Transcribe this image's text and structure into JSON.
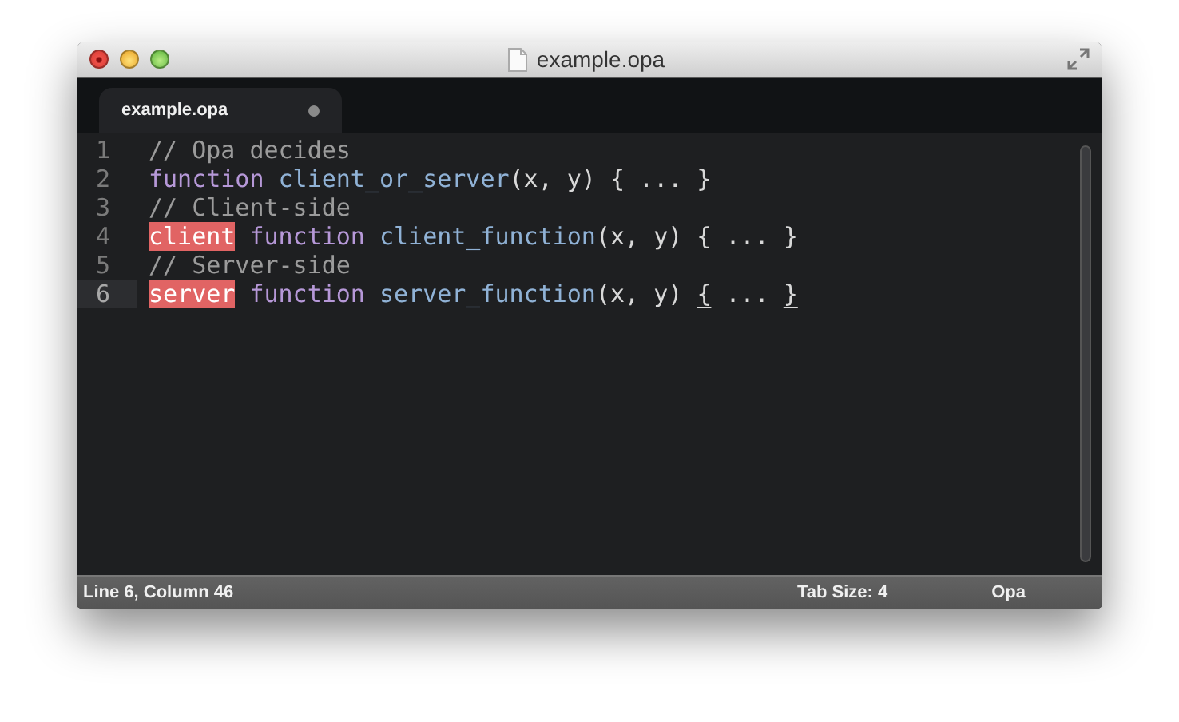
{
  "window": {
    "title": "example.opa"
  },
  "tabs": [
    {
      "label": "example.opa",
      "selected": true,
      "dirty": true
    }
  ],
  "editor": {
    "lines": [
      {
        "number": "1",
        "current": false,
        "tokens": [
          {
            "kind": "comment",
            "text": "// Opa decides"
          }
        ]
      },
      {
        "number": "2",
        "current": false,
        "tokens": [
          {
            "kind": "keyword",
            "text": "function "
          },
          {
            "kind": "name",
            "text": "client_or_server"
          },
          {
            "kind": "plain",
            "text": "(x, y) { ... }"
          }
        ]
      },
      {
        "number": "3",
        "current": false,
        "tokens": [
          {
            "kind": "comment",
            "text": "// Client-side"
          }
        ]
      },
      {
        "number": "4",
        "current": false,
        "tokens": [
          {
            "kind": "storage",
            "text": "client"
          },
          {
            "kind": "keyword",
            "text": " function "
          },
          {
            "kind": "name",
            "text": "client_function"
          },
          {
            "kind": "plain",
            "text": "(x, y) { ... }"
          }
        ]
      },
      {
        "number": "5",
        "current": false,
        "tokens": [
          {
            "kind": "comment",
            "text": "// Server-side"
          }
        ]
      },
      {
        "number": "6",
        "current": true,
        "tokens": [
          {
            "kind": "storage",
            "text": "server"
          },
          {
            "kind": "keyword",
            "text": " function "
          },
          {
            "kind": "name",
            "text": "server_function"
          },
          {
            "kind": "plain",
            "text": "(x, y) "
          },
          {
            "kind": "bracket",
            "text": "{"
          },
          {
            "kind": "plain",
            "text": " ... "
          },
          {
            "kind": "bracket",
            "text": "}"
          }
        ]
      }
    ]
  },
  "status_bar": {
    "position": "Line 6, Column 46",
    "tab_size": "Tab Size: 4",
    "syntax": "Opa"
  }
}
